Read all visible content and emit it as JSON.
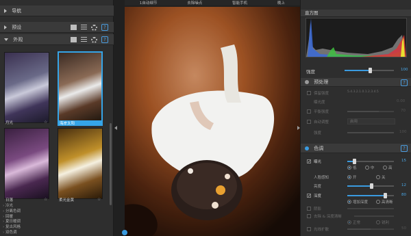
{
  "left": {
    "nav_title": "导航",
    "preset_title": "预设",
    "look_title": "外观",
    "thumbs": [
      {
        "label": "月光"
      },
      {
        "label": "海岸太阳"
      },
      {
        "label": "日落"
      },
      {
        "label": "柔光金黄"
      }
    ],
    "list": [
      "冷光",
      "分离色调",
      "回暖",
      "夏日暖调",
      "复古风格",
      "双色调"
    ]
  },
  "topbar": [
    "1自动细节",
    "去除噪点",
    "智能手机",
    "晚上"
  ],
  "right": {
    "histogram_title": "直方图",
    "strength_label": "强度",
    "strength_value": "100",
    "prep_title": "预处理",
    "prep_rows": [
      {
        "label": "保留强度",
        "value": "5.4.3.2.1.0.1.2.3.4.5"
      },
      {
        "label": "曝光度",
        "value": "0.00"
      },
      {
        "label": "平衡强度",
        "value": "70"
      },
      {
        "label": "自动调整",
        "value": "启用"
      },
      {
        "label": "强度",
        "value": "100"
      }
    ],
    "tone_title": "色调",
    "exposure_label": "曝光",
    "exposure_value": "15",
    "exp_opts": [
      "低",
      "中",
      "高"
    ],
    "portrait_label": "人脸感知",
    "portrait_opts": [
      "开",
      "关"
    ],
    "brightness_label": "亮度",
    "brightness_value": "12",
    "depth_label": "深度",
    "depth_value": "80",
    "depth_opts": [
      "增加深度",
      "高清晰"
    ],
    "shadow_label": "阴影",
    "clarity_label": "去除 & 深度清晰",
    "clarity_opts": [
      "正常",
      "锐利"
    ],
    "glow_label": "光线扩散",
    "glow_value": "50"
  }
}
